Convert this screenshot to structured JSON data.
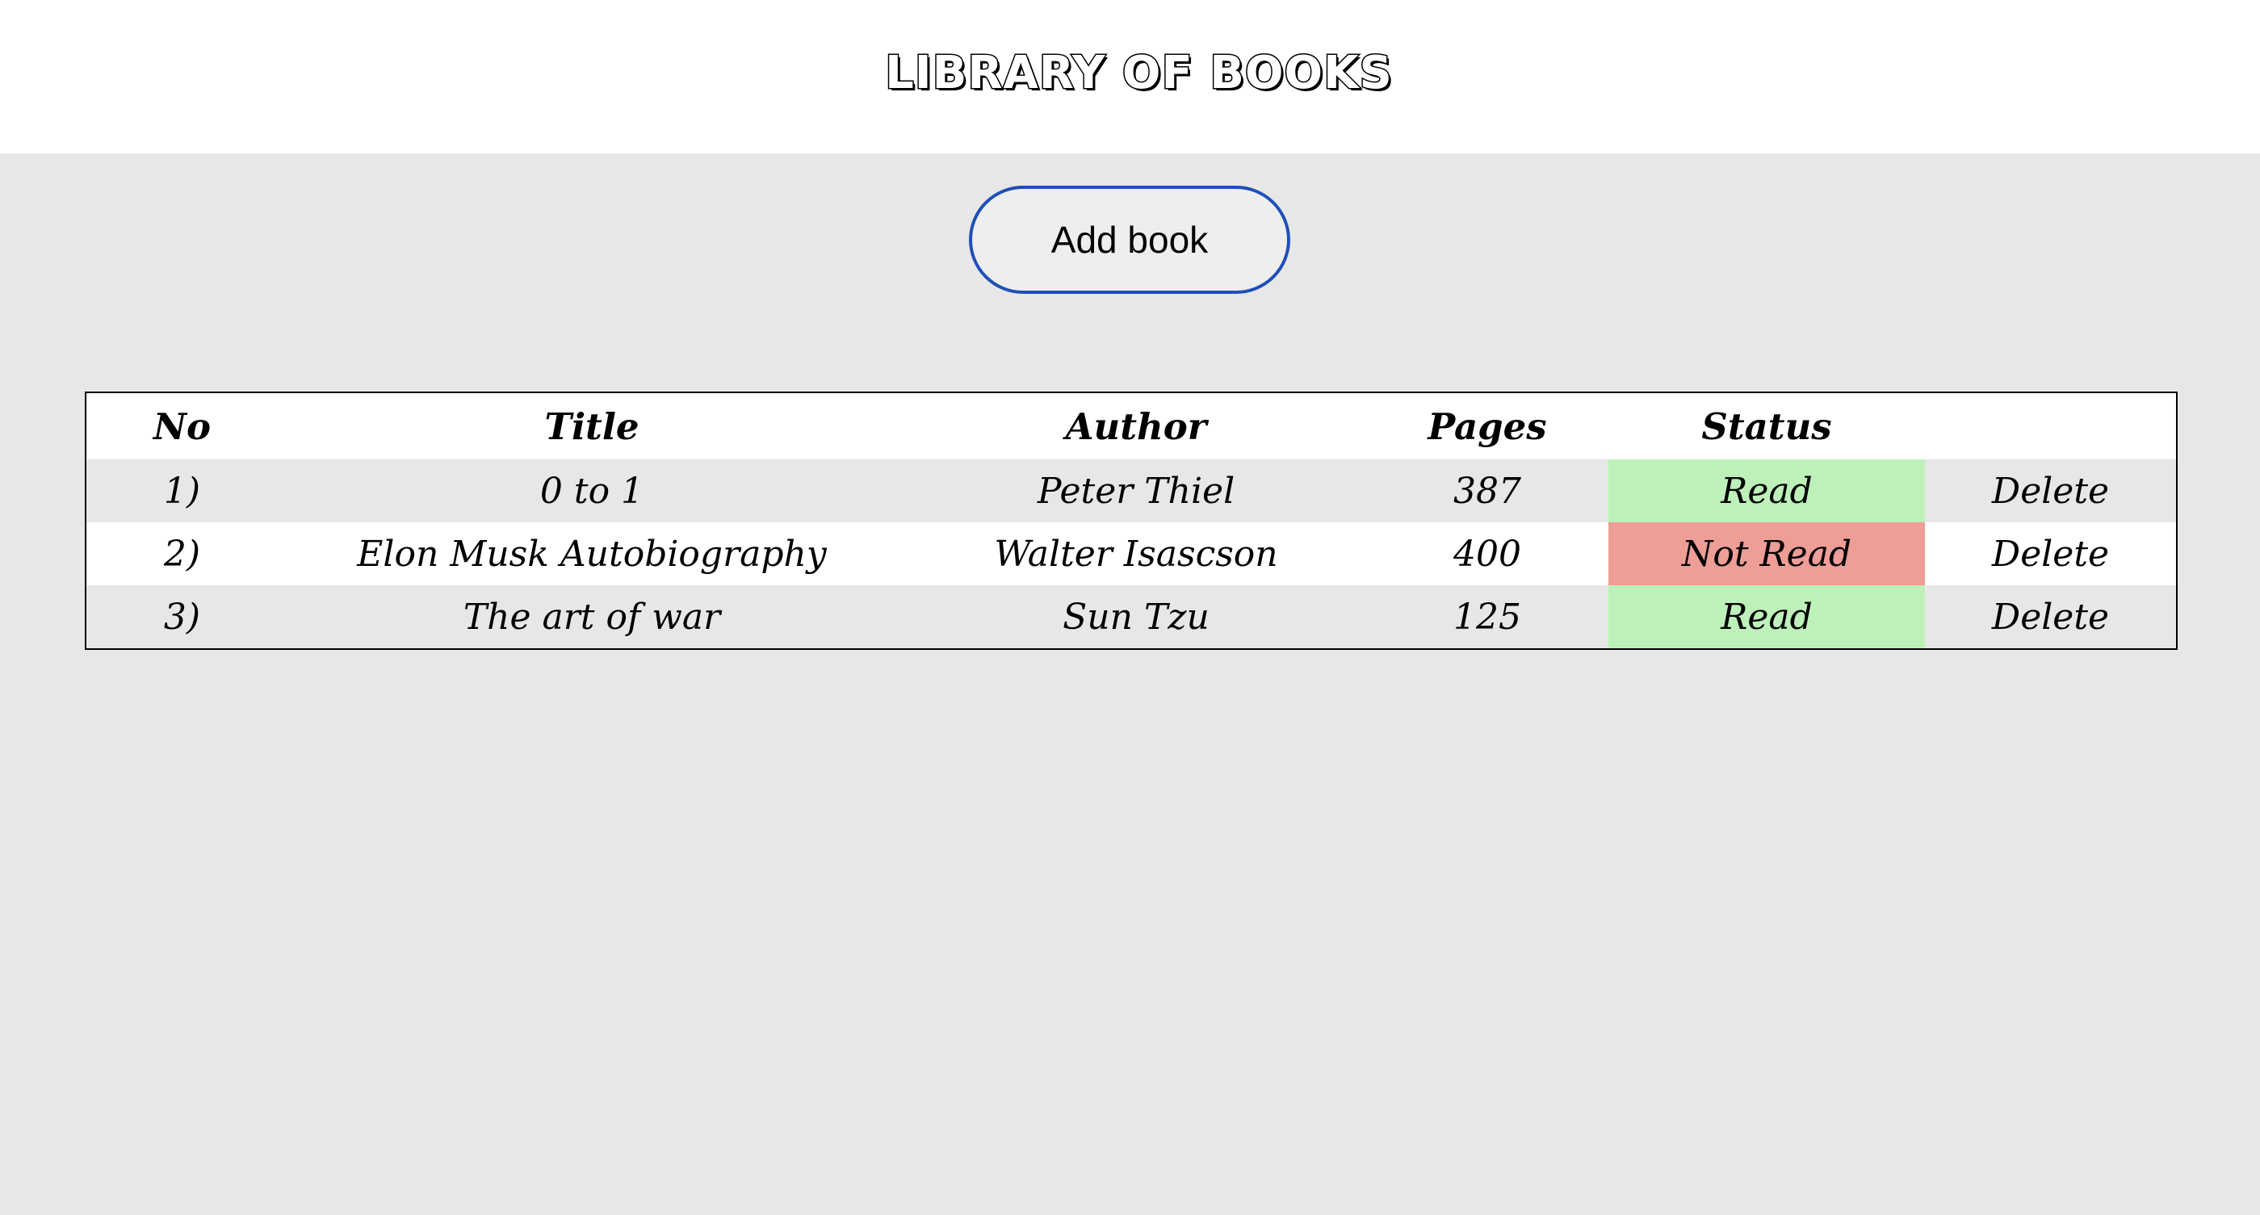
{
  "header": {
    "title": "LIBRARY OF BOOKS"
  },
  "actions": {
    "add_book_label": "Add book"
  },
  "table": {
    "columns": {
      "no": "No",
      "title": "Title",
      "author": "Author",
      "pages": "Pages",
      "status": "Status",
      "actions": ""
    },
    "rows": [
      {
        "no": "1)",
        "title": "0 to 1",
        "author": "Peter Thiel",
        "pages": "387",
        "status": "Read",
        "status_color": "#bdf1b9",
        "delete_label": "Delete"
      },
      {
        "no": "2)",
        "title": "Elon Musk Autobiography",
        "author": "Walter Isascson",
        "pages": "400",
        "status": "Not Read",
        "status_color": "#ef9d97",
        "delete_label": "Delete"
      },
      {
        "no": "3)",
        "title": "The art of war",
        "author": "Sun Tzu",
        "pages": "125",
        "status": "Read",
        "status_color": "#bdf1b9",
        "delete_label": "Delete"
      }
    ]
  },
  "colors": {
    "background": "#e7e7e7",
    "header_background": "#ffffff",
    "button_border": "#1f4fb8",
    "read": "#bdf1b9",
    "not_read": "#ef9d97"
  }
}
